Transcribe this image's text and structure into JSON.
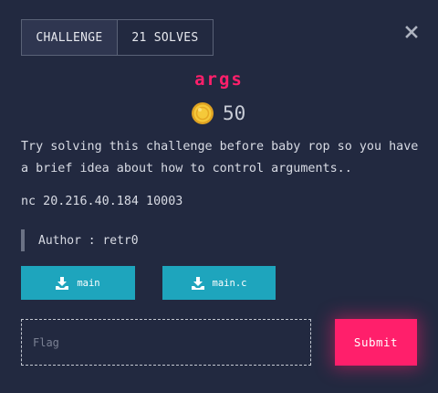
{
  "tabs": [
    {
      "label": "CHALLENGE",
      "active": true
    },
    {
      "label": "21 SOLVES",
      "active": false
    }
  ],
  "close_icon": "close-icon",
  "challenge": {
    "name": "args",
    "points": "50",
    "points_icon": "coin-icon",
    "description": "Try solving this challenge before baby rop so you have a brief idea about how to control arguments..",
    "connection": "nc 20.216.40.184 10003",
    "author": "Author : retr0"
  },
  "files": [
    {
      "label": "main",
      "icon": "download-icon"
    },
    {
      "label": "main.c",
      "icon": "download-icon"
    }
  ],
  "flag_input": {
    "placeholder": "Flag",
    "value": ""
  },
  "submit_label": "Submit",
  "colors": {
    "background": "#222940",
    "accent": "#ff1f6b",
    "file_button": "#1ea5bd",
    "coin": "#f2c230"
  }
}
